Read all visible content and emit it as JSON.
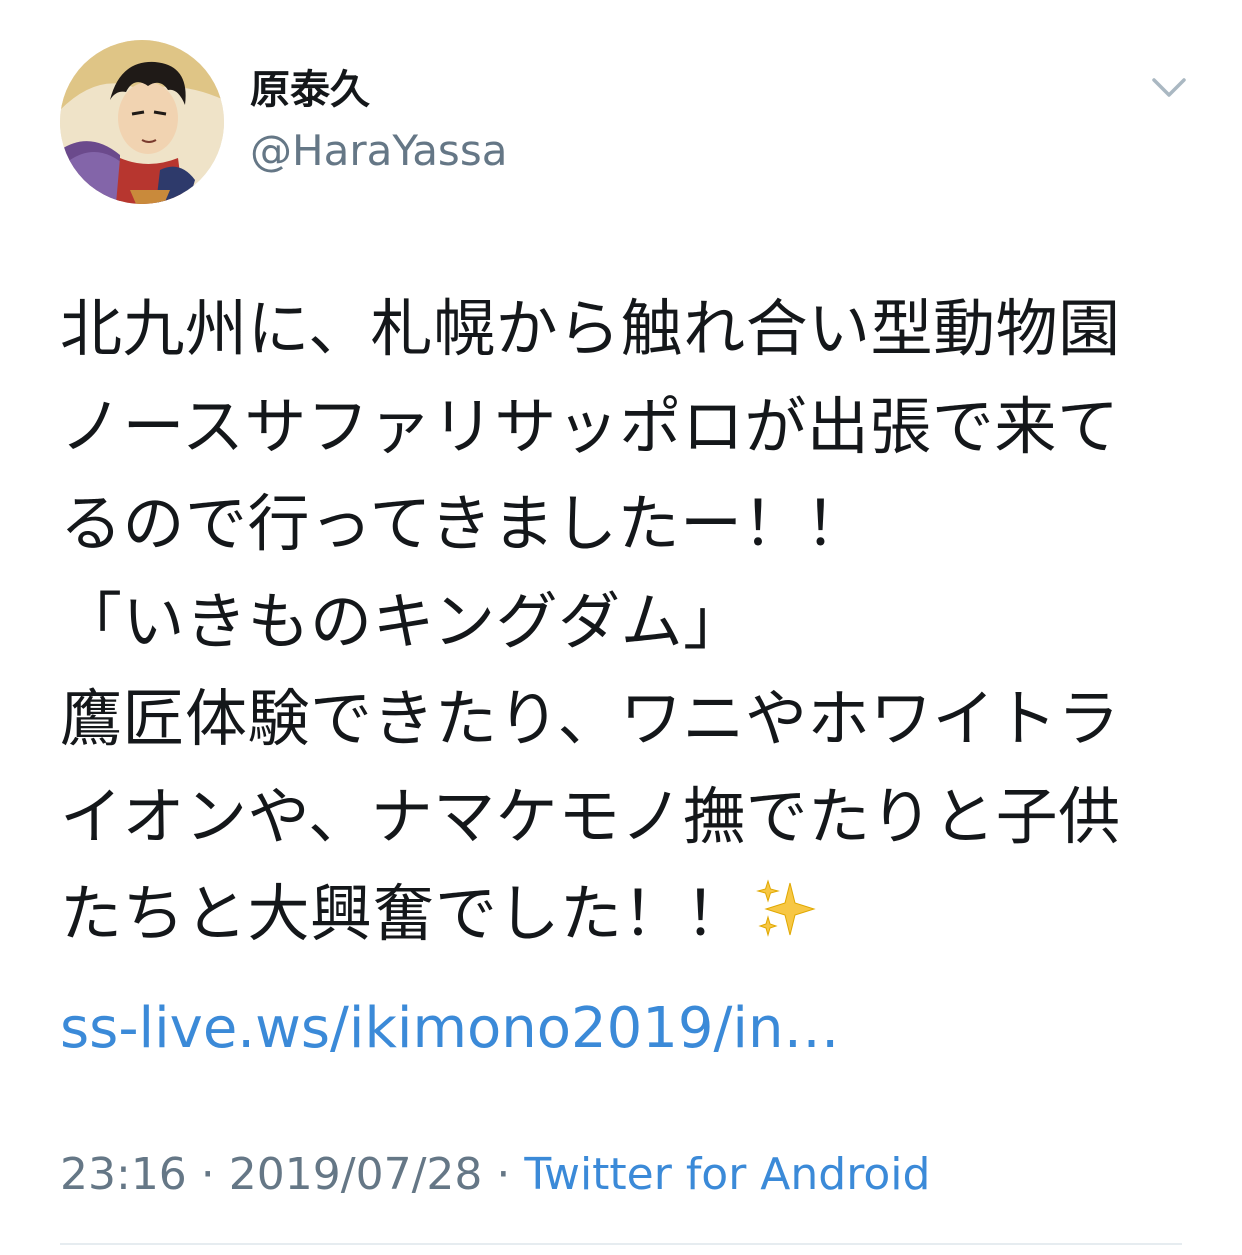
{
  "user": {
    "display_name": "原泰久",
    "handle": "@HaraYassa",
    "avatar_icon": "manga-character-avatar"
  },
  "menu": {
    "icon": "chevron-down-icon"
  },
  "tweet": {
    "lines": [
      "北九州に、札幌から触れ合い型動物園",
      "ノースサファリサッポロが出張で来て",
      "るので行ってきましたー！！",
      "「いきものキングダム」",
      "鷹匠体験できたり、ワニやホワイトラ",
      "イオンや、ナマケモノ撫でたりと子供",
      "たちと大興奮でした！！"
    ],
    "emoji_icon": "sparkles-icon",
    "link_text": "ss-live.ws/ikimono2019/in…"
  },
  "meta": {
    "time": "23:16",
    "separator": " · ",
    "date": "2019/07/28",
    "source": "Twitter for Android"
  },
  "colors": {
    "text": "#14171a",
    "secondary": "#657786",
    "link": "#3b8ad8",
    "divider": "#e6ecf0"
  }
}
